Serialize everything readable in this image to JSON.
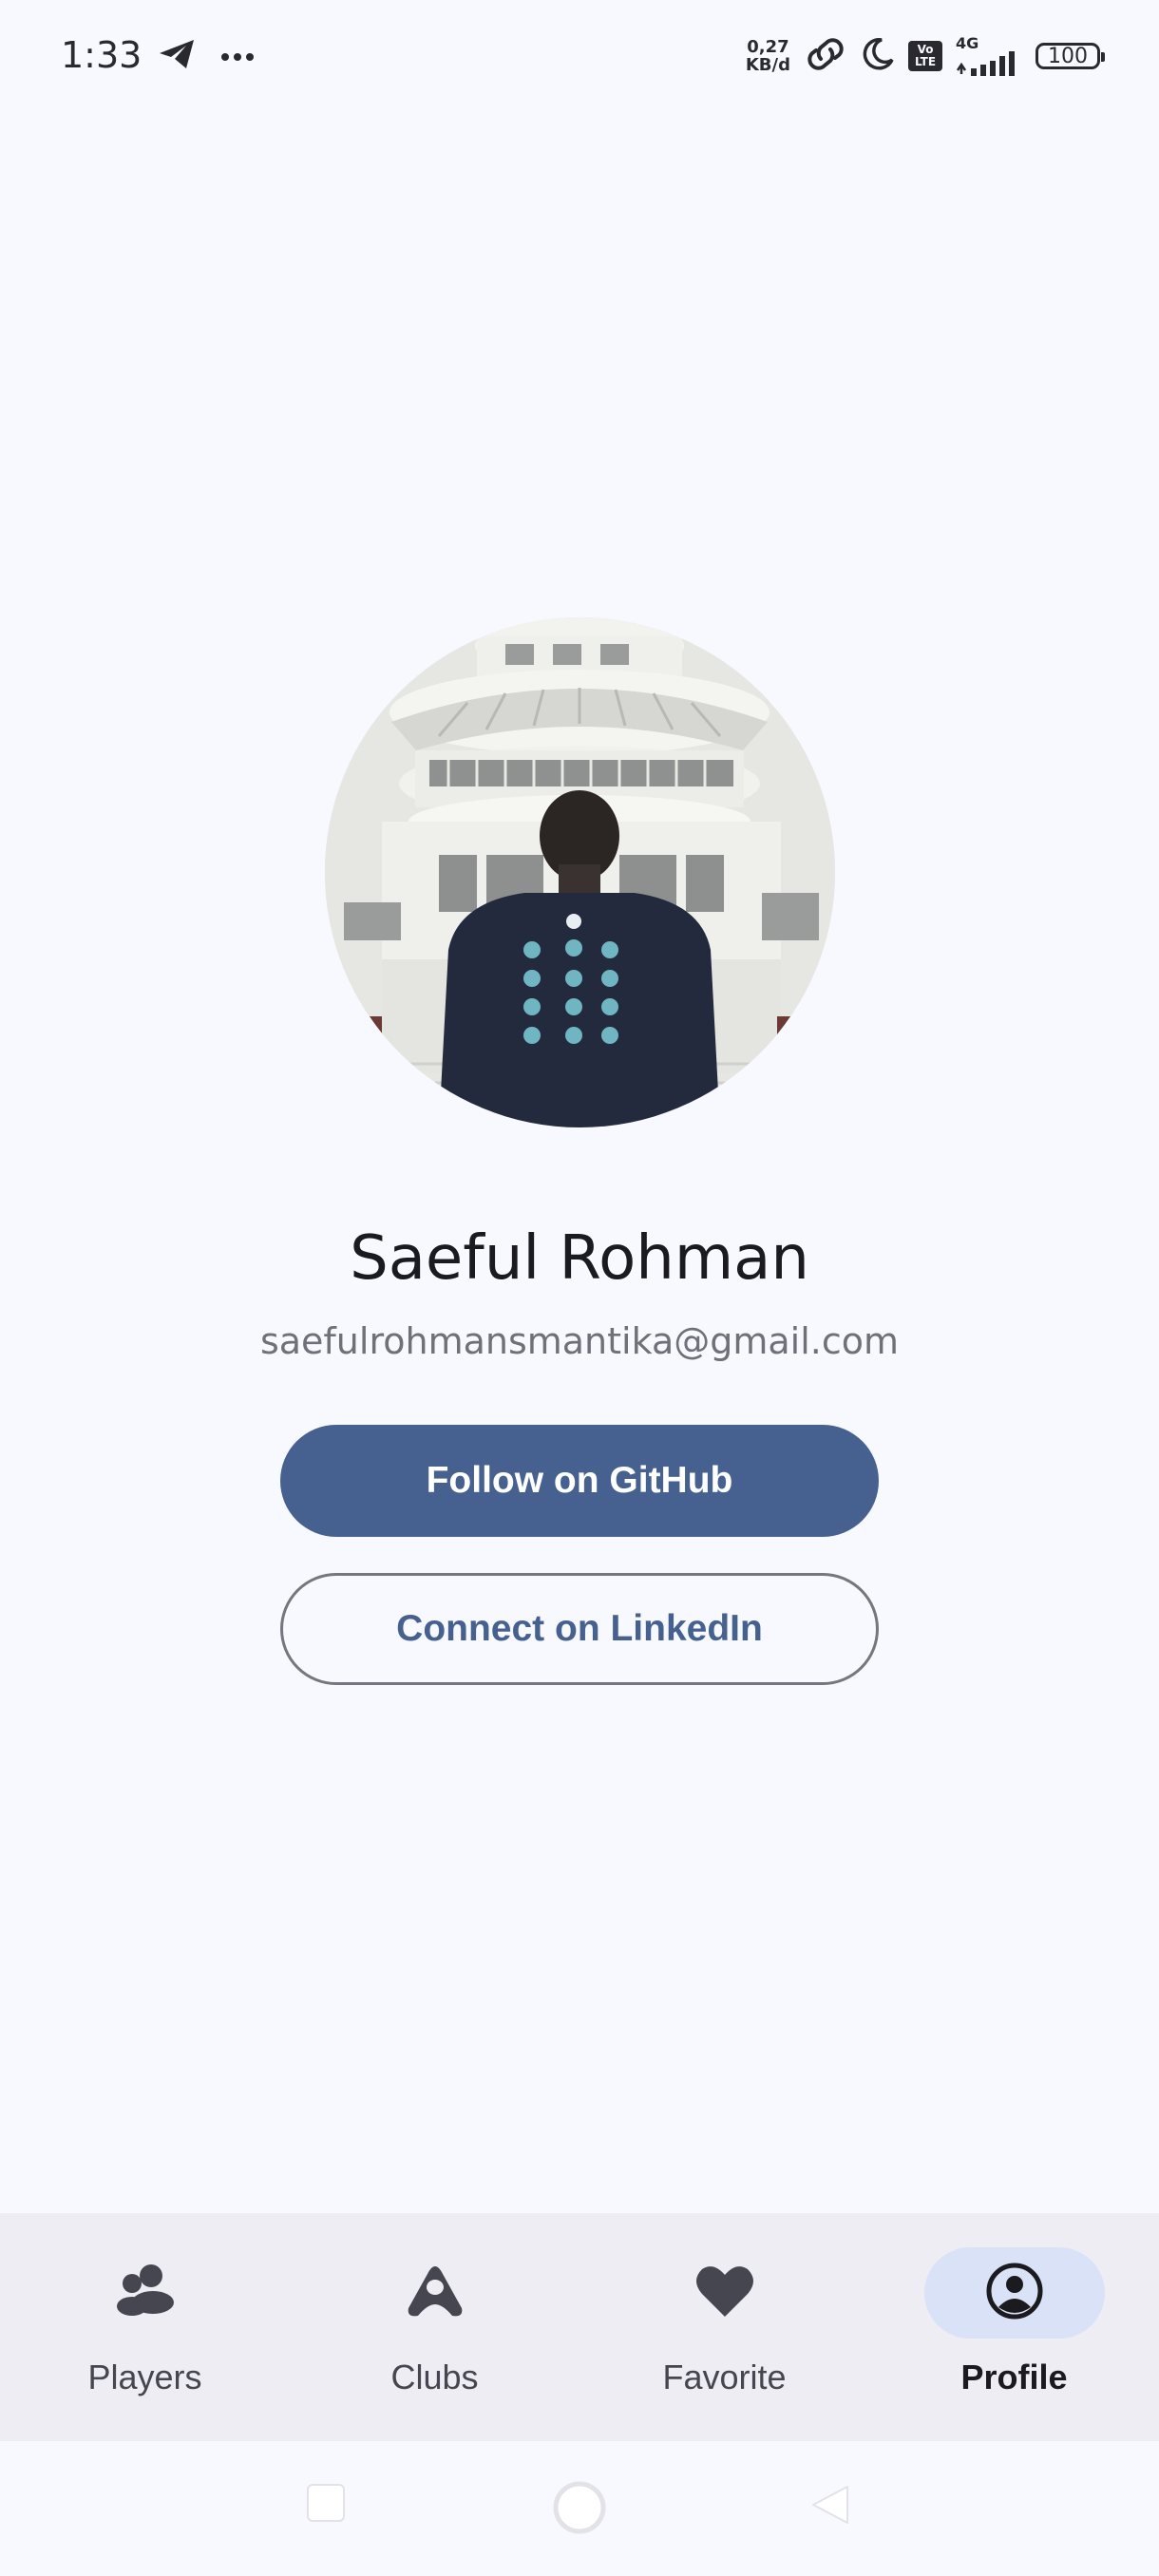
{
  "status_bar": {
    "time": "1:33",
    "speed_value": "0,27",
    "speed_unit": "KB/d",
    "volte_line1": "Vo",
    "volte_line2": "LTE",
    "network": "4G",
    "battery": "100",
    "icons": [
      "telegram-icon",
      "more-dots-icon",
      "hotspot-link-icon",
      "do-not-disturb-moon-icon",
      "volte-icon",
      "signal-icon",
      "battery-icon"
    ]
  },
  "profile": {
    "name": "Saeful Rohman",
    "email": "saefulrohmansmantika@gmail.com",
    "avatar_icon": "profile-photo"
  },
  "actions": {
    "github_label": "Follow on GitHub",
    "linkedin_label": "Connect on LinkedIn"
  },
  "colors": {
    "primary": "#46618f",
    "background": "#f8f9ff",
    "nav_background": "#eeedf4",
    "active_indicator": "#d9e2f7"
  },
  "bottom_nav": {
    "items": [
      {
        "label": "Players",
        "icon": "people-icon",
        "active": false
      },
      {
        "label": "Clubs",
        "icon": "clubs-icon",
        "active": false
      },
      {
        "label": "Favorite",
        "icon": "heart-icon",
        "active": false
      },
      {
        "label": "Profile",
        "icon": "account-circle-icon",
        "active": true
      }
    ]
  },
  "system_nav": {
    "icons": [
      "recents-square-icon",
      "home-circle-icon",
      "back-triangle-icon"
    ]
  }
}
